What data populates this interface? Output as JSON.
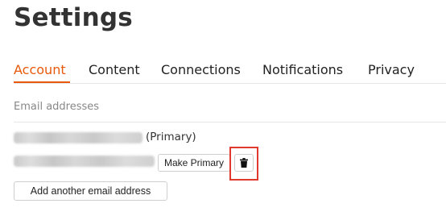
{
  "page": {
    "title": "Settings"
  },
  "tabs": [
    {
      "label": "Account",
      "active": true
    },
    {
      "label": "Content",
      "active": false
    },
    {
      "label": "Connections",
      "active": false
    },
    {
      "label": "Notifications",
      "active": false
    },
    {
      "label": "Privacy",
      "active": false
    }
  ],
  "email_section": {
    "label": "Email addresses",
    "primary_tag": "(Primary)",
    "make_primary_label": "Make Primary",
    "delete_icon": "trash-icon",
    "add_label": "Add another email address"
  },
  "colors": {
    "accent": "#e8590c",
    "highlight": "#e03a2f"
  }
}
